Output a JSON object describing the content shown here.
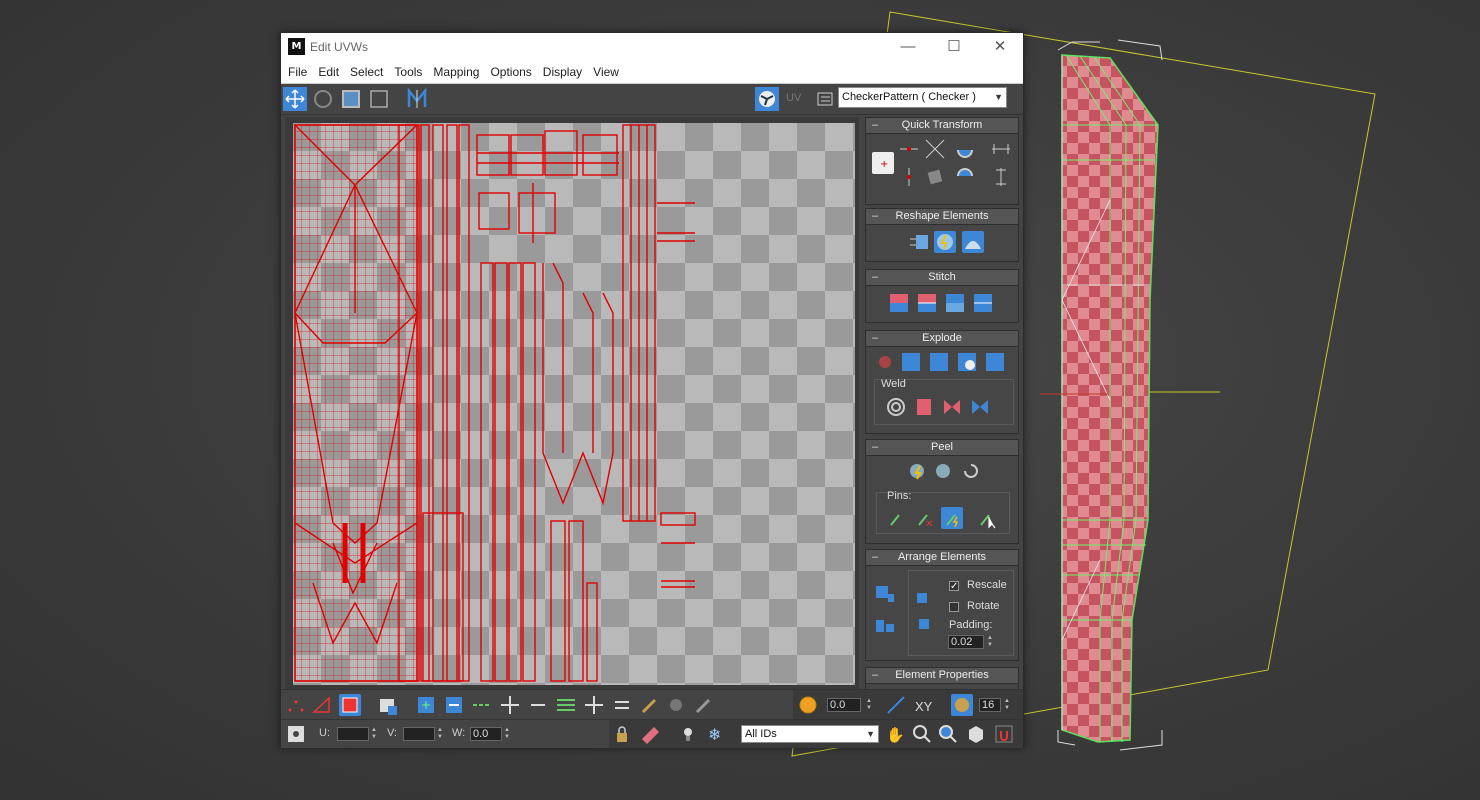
{
  "window": {
    "title": "Edit UVWs",
    "logo": "M",
    "minimize": "—",
    "maximize": "☐",
    "close": "✕"
  },
  "menu": [
    "File",
    "Edit",
    "Select",
    "Tools",
    "Mapping",
    "Options",
    "Display",
    "View"
  ],
  "toolbar": {
    "texture_dropdown": "CheckerPattern  ( Checker )",
    "uv_label": "UV"
  },
  "panels": {
    "quick_transform": "Quick Transform",
    "reshape": "Reshape Elements",
    "stitch": "Stitch",
    "explode": "Explode",
    "weld": "Weld",
    "peel": "Peel",
    "pins": "Pins:",
    "arrange": "Arrange Elements",
    "rescale": "Rescale",
    "rescale_checked": true,
    "rotate": "Rotate",
    "rotate_checked": false,
    "padding_label": "Padding:",
    "padding_value": "0.02",
    "element_properties": "Element Properties"
  },
  "bottom": {
    "soft_value": "0.0",
    "xy_label": "XY",
    "grid_value": "16",
    "u_label": "U:",
    "v_label": "V:",
    "w_label": "W:",
    "w_value": "0.0",
    "ids_dropdown": "All IDs"
  },
  "colors": {
    "uv_wire": "#e00000",
    "active_blue": "#3d87d6",
    "bbox_yellow": "#c8c82a",
    "mesh_green": "#5ee05e",
    "mesh_red": "#c84a55"
  }
}
